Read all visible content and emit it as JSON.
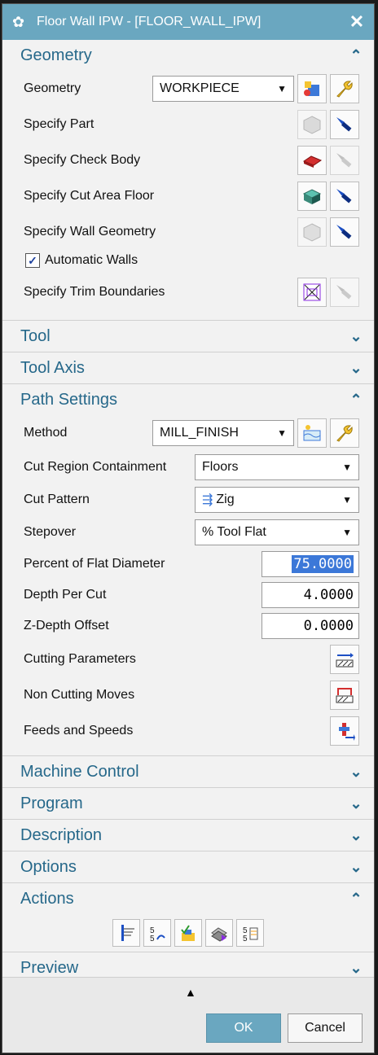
{
  "window": {
    "title": "Floor Wall IPW - [FLOOR_WALL_IPW]"
  },
  "sections": {
    "geometry": {
      "label": "Geometry",
      "expanded": true
    },
    "tool": {
      "label": "Tool",
      "expanded": false
    },
    "tool_axis": {
      "label": "Tool Axis",
      "expanded": false
    },
    "path_settings": {
      "label": "Path Settings",
      "expanded": true
    },
    "machine_control": {
      "label": "Machine Control",
      "expanded": false
    },
    "program": {
      "label": "Program",
      "expanded": false
    },
    "description": {
      "label": "Description",
      "expanded": false
    },
    "options": {
      "label": "Options",
      "expanded": false
    },
    "actions": {
      "label": "Actions",
      "expanded": true
    },
    "preview": {
      "label": "Preview",
      "expanded": false
    }
  },
  "geometry": {
    "geometry_label": "Geometry",
    "geometry_value": "WORKPIECE",
    "specify_part": "Specify Part",
    "specify_check_body": "Specify Check Body",
    "specify_cut_area_floor": "Specify Cut Area Floor",
    "specify_wall_geometry": "Specify Wall Geometry",
    "automatic_walls": "Automatic Walls",
    "automatic_walls_checked": true,
    "specify_trim_boundaries": "Specify Trim Boundaries"
  },
  "path": {
    "method_label": "Method",
    "method_value": "MILL_FINISH",
    "cut_region_label": "Cut Region Containment",
    "cut_region_value": "Floors",
    "cut_pattern_label": "Cut Pattern",
    "cut_pattern_value": "Zig",
    "stepover_label": "Stepover",
    "stepover_value": "% Tool Flat",
    "percent_flat_label": "Percent of Flat Diameter",
    "percent_flat_value": "75.0000",
    "depth_per_cut_label": "Depth Per Cut",
    "depth_per_cut_value": "4.0000",
    "z_depth_label": "Z-Depth Offset",
    "z_depth_value": "0.0000",
    "cutting_params": "Cutting Parameters",
    "non_cutting": "Non Cutting Moves",
    "feeds_speeds": "Feeds and Speeds"
  },
  "buttons": {
    "ok": "OK",
    "cancel": "Cancel"
  },
  "icons": {
    "gear": "gear-icon",
    "close": "close-icon",
    "chevron_up": "chevron-up-icon",
    "chevron_down": "chevron-down-icon"
  },
  "colors": {
    "accent": "#6aa7c0",
    "section_text": "#26688a",
    "selected": "#3c78d8"
  }
}
